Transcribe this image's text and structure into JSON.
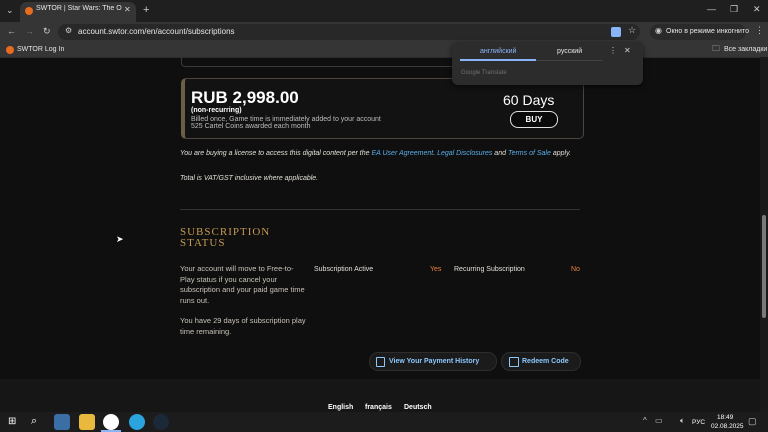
{
  "browser": {
    "tab_title": "SWTOR | Star Wars: The Old Re",
    "url": "account.swtor.com/en/account/subscriptions",
    "incognito_label": "Окно в режиме инкогнито",
    "bookmark_swtor": "SWTOR Log In",
    "all_bookmarks": "Все закладки"
  },
  "translate": {
    "lang_source": "английский",
    "lang_target": "русский",
    "brand": "Google Translate"
  },
  "offer": {
    "price": "RUB 2,998.00",
    "type": "(non-recurring)",
    "line1": "Billed once, Game time is immediately added to your account",
    "line2": "525 Cartel Coins awarded each month",
    "duration": "60 Days",
    "buy": "BUY"
  },
  "license": {
    "prefix": "You are buying a license to access this digital content per the",
    "ea_agreement": "EA User Agreement",
    "legal": "Legal Disclosures",
    "and": "and",
    "terms": "Terms of Sale",
    "apply": "apply.",
    "vat": "Total is VAT/GST inclusive where applicable."
  },
  "subscription": {
    "title_line1": "SUBSCRIPTION",
    "title_line2": "STATUS",
    "note1": "Your account will move to Free-to-Play status if you cancel your subscription and your paid game time runs out.",
    "note2": "You have 29 days of subscription play time remaining.",
    "active_label": "Subscription Active",
    "active_value": "Yes",
    "recurring_label": "Recurring Subscription",
    "recurring_value": "No",
    "history_button": "View Your Payment History",
    "redeem_button": "Redeem Code"
  },
  "footer": {
    "languages": [
      "English",
      "français",
      "Deutsch"
    ]
  },
  "taskbar": {
    "time": "18:49",
    "date": "02.08.2025",
    "lang": "РУС"
  },
  "colors": {
    "accent_gold": "#c59a52",
    "link_blue": "#5aaee8",
    "yes_no_orange": "#e8823c"
  }
}
